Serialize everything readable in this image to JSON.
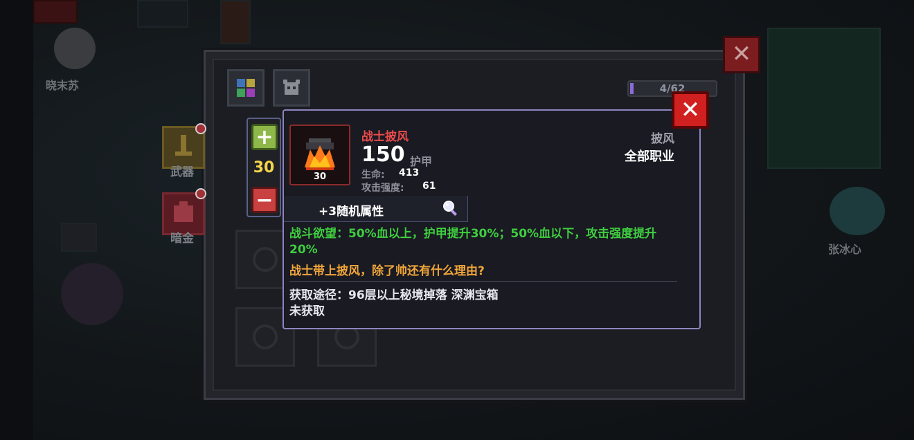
{
  "npcs": {
    "left_name": "晓末苏",
    "right_name": "张冰心"
  },
  "inventory": {
    "counter": "4/62",
    "side_categories": [
      {
        "label": "武器"
      },
      {
        "label": "暗金"
      }
    ]
  },
  "stepper": {
    "value": "30"
  },
  "item": {
    "name": "战士披风",
    "armor_value": "150",
    "armor_label": "护甲",
    "stats": [
      {
        "label": "生命:",
        "value": "413"
      },
      {
        "label": "攻击强度:",
        "value": "61"
      }
    ],
    "level_badge": "30",
    "type": "披风",
    "class": "全部职业",
    "random_attr": "+3随机属性",
    "effect": "战斗欲望：50%血以上，护甲提升30%；50%血以下，攻击强度提升20%",
    "flavor": "战士带上披风，除了帅还有什么理由?",
    "source": "获取途径：96层以上秘境掉落 深渊宝箱",
    "status": "未获取"
  },
  "colors": {
    "item_name": "#ec4b4b",
    "effect": "#3fce3f",
    "flavor": "#f0a53a",
    "stepper_value": "#f5d44a",
    "close_button": "#d12020",
    "tooltip_border": "#8e84bf"
  },
  "icons": {
    "close": "close-icon",
    "plus": "plus-icon",
    "minus": "minus-icon",
    "magnifier": "magnifier-icon",
    "item": "flame-cape-icon"
  }
}
